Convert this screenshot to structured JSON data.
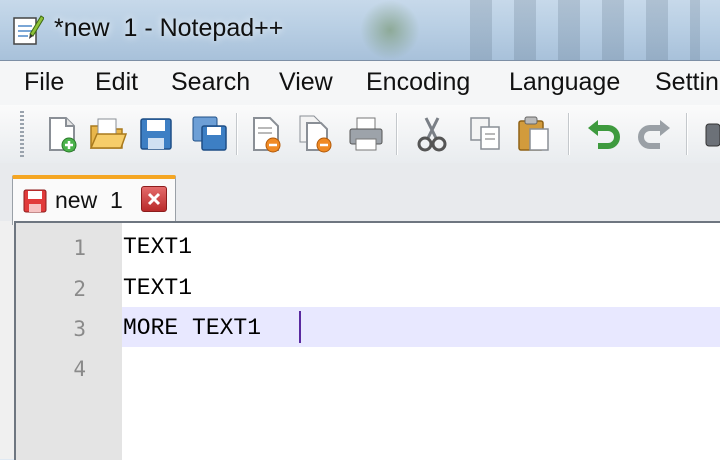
{
  "window": {
    "title": "*new  1 - Notepad++"
  },
  "menu": {
    "items": [
      "File",
      "Edit",
      "Search",
      "View",
      "Encoding",
      "Language",
      "Settin"
    ]
  },
  "toolbar": {
    "buttons": [
      {
        "name": "new-file-icon"
      },
      {
        "name": "open-file-icon"
      },
      {
        "name": "save-icon"
      },
      {
        "name": "save-all-icon"
      },
      {
        "name": "close-icon"
      },
      {
        "name": "close-all-icon"
      },
      {
        "name": "print-icon"
      },
      {
        "name": "cut-icon"
      },
      {
        "name": "copy-icon"
      },
      {
        "name": "paste-icon"
      },
      {
        "name": "undo-icon"
      },
      {
        "name": "redo-icon"
      }
    ]
  },
  "tabs": [
    {
      "label": "new  1",
      "modified": true
    }
  ],
  "editor": {
    "lines": [
      "TEXT1",
      "TEXT1",
      "MORE TEXT1",
      ""
    ],
    "line_numbers": [
      "1",
      "2",
      "3",
      "4"
    ],
    "current_line": 3
  },
  "colors": {
    "current_line": "#e8e8ff",
    "gutter": "#e4e4e4",
    "tab_accent": "#f5a623"
  }
}
